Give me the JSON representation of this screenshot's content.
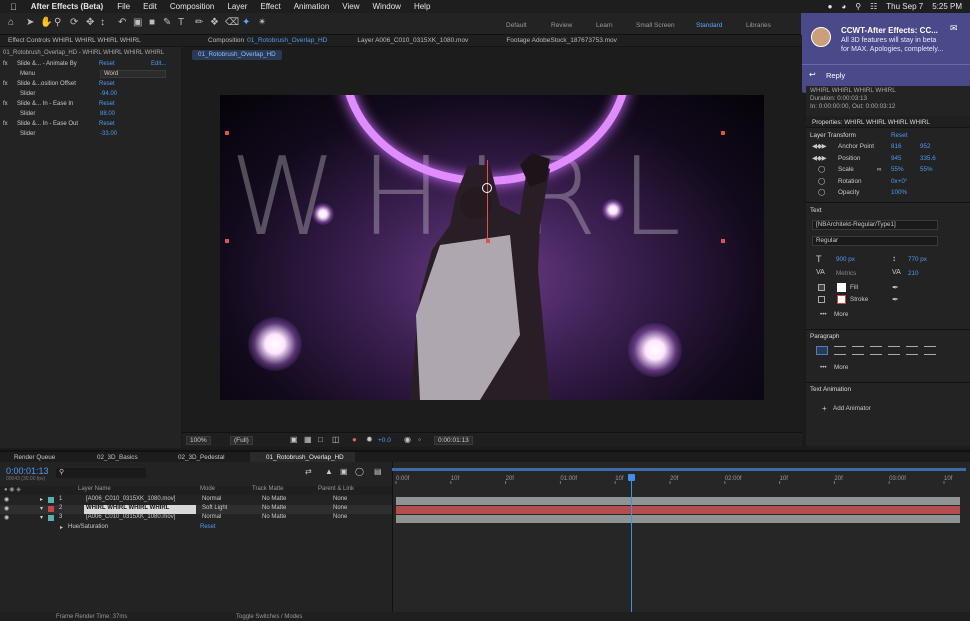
{
  "menubar": {
    "app": "After Effects (Beta)",
    "items": [
      "File",
      "Edit",
      "Composition",
      "Layer",
      "Effect",
      "Animation",
      "View",
      "Window",
      "Help"
    ],
    "date": "Thu Sep 7",
    "time": "5:25 PM"
  },
  "workspaces": [
    "Default",
    "Review",
    "Learn",
    "Small Screen",
    "Standard",
    "Libraries"
  ],
  "notification": {
    "title": "CCWT-After Effects: CC...",
    "body_line1": "All 3D features will stay in beta",
    "body_line2": "for MAX. Apologies, completely...",
    "reply": "Reply"
  },
  "effect_controls": {
    "tab": "Effect Controls WHIRL WHIRL WHIRL WHIRL",
    "layer_path": "01_Rotobrush_Overlap_HD - WHIRL WHIRL WHIRL WHIRL",
    "rows": [
      {
        "label": "Slide &... - Animate By",
        "value": "Reset",
        "extra": "Edit..."
      },
      {
        "label": "Menu",
        "value": "Word"
      },
      {
        "label": "Slide &...osition Offset",
        "value": "Reset"
      },
      {
        "label": "Slider",
        "value": "-94.00"
      },
      {
        "label": "Slide &... In - Ease In",
        "value": "Reset"
      },
      {
        "label": "Slider",
        "value": "88.00"
      },
      {
        "label": "Slide &... In - Ease Out",
        "value": "Reset"
      },
      {
        "label": "Slider",
        "value": "-33.00"
      }
    ]
  },
  "comp_tabs": {
    "composition": "Composition",
    "comp_name": "01_Rotobrush_Overlap_HD",
    "layer_tab": "Layer A006_C010_0315XK_1080.mov",
    "footage_tab": "Footage AdobeStock_187673753.mov",
    "breadcrumb": "01_Rotobrush_Overlap_HD"
  },
  "viewer": {
    "text": "WHIRL"
  },
  "viewbar": {
    "zoom": "100%",
    "resolution": "(Full)",
    "exposure": "+0.0",
    "timecode": "0:00:01:13"
  },
  "properties": {
    "info_line1": "WHIRL WHIRL WHIRL WHIRL",
    "info_line2": "Duration: 0:00:03:13",
    "info_line3": "In: 0:00:00:00, Out: 0:00:03:12",
    "header": "Properties: WHIRL WHIRL WHIRL WHIRL",
    "layer_transform": "Layer Transform",
    "reset": "Reset",
    "anchor_label": "Anchor Point",
    "anchor_x": "816",
    "anchor_y": "952",
    "position_label": "Position",
    "position_x": "945",
    "position_y": "335.6",
    "scale_label": "Scale",
    "scale_x": "55%",
    "scale_y": "55%",
    "rotation_label": "Rotation",
    "rotation": "0x+0°",
    "opacity_label": "Opacity",
    "opacity": "100%",
    "text_section": "Text",
    "font": "[NBArchitekt-Regular/Type1]",
    "style": "Regular",
    "font_size": "900 px",
    "leading": "770 px",
    "kerning": "Metrics",
    "tracking": "210",
    "fill": "Fill",
    "stroke": "Stroke",
    "more": "More",
    "paragraph": "Paragraph",
    "text_animation": "Text Animation",
    "add_animator": "Add Animator"
  },
  "bottom_tabs": [
    "Render Queue",
    "02_3D_Basics",
    "02_3D_Pedestal",
    "01_Rotobrush_Overlap_HD"
  ],
  "timeline": {
    "timecode": "0:00:01:13",
    "frames": "00043 (30.00 fps)",
    "headers": {
      "layer_name": "Layer Name",
      "mode": "Mode",
      "track_matte": "Track Matte",
      "parent": "Parent & Link"
    },
    "layers": [
      {
        "num": "1",
        "name": "[A006_C010_0315XK_1080.mov]",
        "mode": "Normal",
        "matte": "No Matte",
        "parent": "None",
        "color": "#5ab0b0"
      },
      {
        "num": "2",
        "name": "WHIRL WHIRL WHIRL WHIRL",
        "mode": "Soft Light",
        "matte": "No Matte",
        "parent": "None",
        "color": "#c44848"
      },
      {
        "num": "3",
        "name": "[A006_C010_0315XK_1080.mov]",
        "mode": "Normal",
        "matte": "No Matte",
        "parent": "None",
        "color": "#5ab0b0"
      }
    ],
    "effect": "Hue/Saturation",
    "effect_value": "Reset",
    "ruler": [
      "0:00f",
      "10f",
      "20f",
      "01:00f",
      "10f",
      "20f",
      "02:00f",
      "10f",
      "20f",
      "03:00f",
      "10f"
    ],
    "footer_left": "Frame Render Time: 37ms",
    "footer_mid": "Toggle Switches / Modes"
  }
}
